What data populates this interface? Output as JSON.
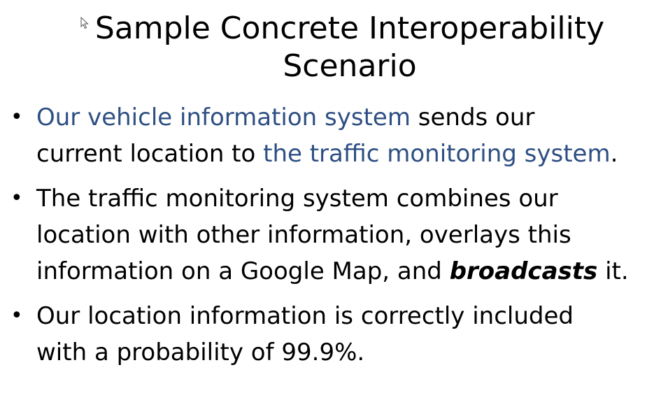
{
  "slide": {
    "title_line1": "Sample Concrete Interoperability",
    "title_line2": "Scenario",
    "bullet_char": "•",
    "accent_color": "#2e4f83",
    "bullets": [
      {
        "line1_hl": "Our vehicle information system",
        "line1_rest": " sends our",
        "line2_pre": "current location to ",
        "line2_hl": "the traffic monitoring system",
        "line2_post": "."
      },
      {
        "line1": "The traffic monitoring system combines our",
        "line2": "location with other information, overlays this",
        "line3_pre": "information on a Google Map, and ",
        "line3_emph": "broadcasts",
        "line3_post": " it."
      },
      {
        "line1": "Our location information is correctly included",
        "line2": "with a probability of 99.9%."
      }
    ]
  },
  "cursor": {
    "icon": "mouse-pointer-icon"
  }
}
